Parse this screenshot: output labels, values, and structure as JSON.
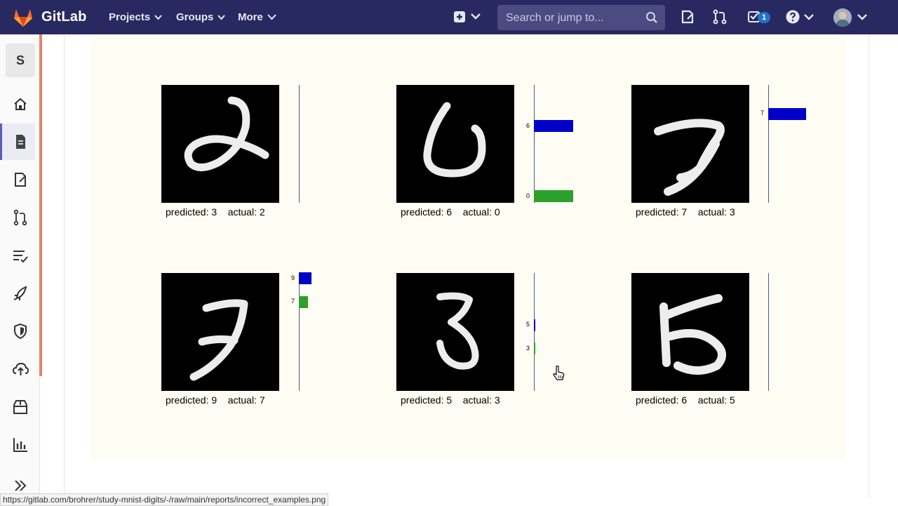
{
  "navbar": {
    "brand": "GitLab",
    "projects_label": "Projects",
    "groups_label": "Groups",
    "more_label": "More",
    "search_placeholder": "Search or jump to...",
    "todo_count": "1"
  },
  "sidebar": {
    "project_initial": "S"
  },
  "figure": {
    "cells": [
      {
        "caption": "predicted: 3    actual: 2",
        "bars": []
      },
      {
        "caption": "predicted: 6    actual: 0",
        "bars": [
          {
            "label": "6",
            "value": 0.34,
            "color": "#0000c8"
          },
          {
            "label": "0",
            "value": 0.34,
            "color": "#2ca02c"
          }
        ]
      },
      {
        "caption": "predicted: 7    actual: 3",
        "bars": [
          {
            "label": "7",
            "value": 0.33,
            "color": "#0000c8"
          }
        ]
      },
      {
        "caption": "predicted: 9    actual: 7",
        "bars": [
          {
            "label": "9",
            "value": 0.11,
            "color": "#0000c8"
          },
          {
            "label": "7",
            "value": 0.08,
            "color": "#2ca02c"
          }
        ]
      },
      {
        "caption": "predicted: 5    actual: 3",
        "bars": [
          {
            "label": "5",
            "value": 0.01,
            "color": "#0000c8"
          },
          {
            "label": "3",
            "value": 0.01,
            "color": "#2ca02c"
          }
        ]
      },
      {
        "caption": "predicted: 6    actual: 5",
        "bars": []
      }
    ]
  },
  "status_bar": {
    "url": "https://gitlab.com/brohrer/study-mnist-digits/-/raw/main/reports/incorrect_examples.png"
  },
  "colors": {
    "navbar_bg": "#292961",
    "predicted_bar": "#0000c8",
    "actual_bar": "#2ca02c",
    "panel_bg": "#fdfdf3"
  }
}
